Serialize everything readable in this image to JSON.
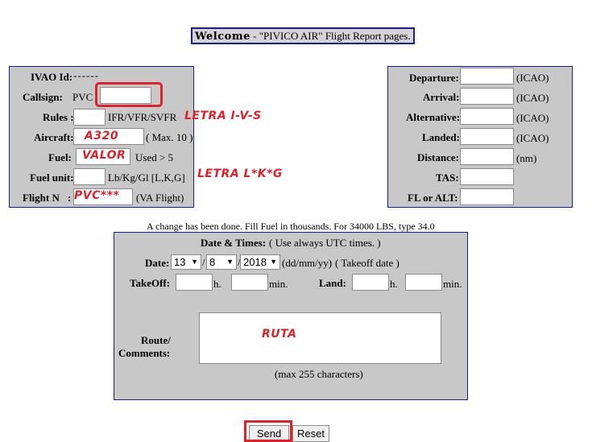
{
  "header": {
    "welcome": "Welcome",
    "rest": " - \"PIVICO AIR\" Flight Report pages."
  },
  "left_form": {
    "ivao_label": "IVAO Id:",
    "ivao_value": "------",
    "callsign_label": "Callsign:",
    "callsign_prefix": "PVC",
    "rules_label": "Rules :",
    "rules_hint": "IFR/VFR/SVFR",
    "aircraft_label": "Aircraft:",
    "aircraft_value": "A320",
    "aircraft_hint": "( Max. 10 )",
    "fuel_label": "Fuel:",
    "fuel_value": "VALOR",
    "fuel_hint": "Used > 5",
    "fuel_unit_label": "Fuel unit:",
    "fuel_unit_hint": "Lb/Kg/Gl [L,K,G]",
    "flight_no_label": "Flight N\u0000:",
    "flight_no_value": "PVC***",
    "flight_no_hint": "(VA Flight)"
  },
  "annotations": {
    "rules": "LETRA I-V-S",
    "fuel_unit": "LETRA L*K*G",
    "route": "RUTA"
  },
  "right_form": {
    "departure_label": "Departure:",
    "arrival_label": "Arrival:",
    "alternative_label": "Alternative:",
    "landed_label": "Landed:",
    "distance_label": "Distance:",
    "tas_label": "TAS:",
    "fl_label": "FL or ALT:",
    "icao_hint": "(ICAO)",
    "nm_hint": "(nm)"
  },
  "notice": "A change has been done. Fill Fuel in thousands. For 34000 LBS, type 34.0",
  "times": {
    "heading_label": "Date & Times:",
    "heading_hint": "( Use always UTC times. )",
    "date_label": "Date:",
    "day": "13",
    "month": "8",
    "year": "2018",
    "date_sep": "/",
    "date_format": "(dd/mm/yy)",
    "date_hint": "( Takeoff date )",
    "takeoff_label": "TakeOff:",
    "land_label": "Land:",
    "h_unit": "h.",
    "min_unit": "min.",
    "route_label_1": "Route/",
    "route_label_2": "Comments:",
    "max_chars": "(max 255 characters)"
  },
  "buttons": {
    "send": "Send",
    "reset": "Reset"
  },
  "colors": {
    "panel_bg": "#c8c8c8",
    "panel_border": "#1a1a9c",
    "annotation_red": "#e0202a"
  }
}
